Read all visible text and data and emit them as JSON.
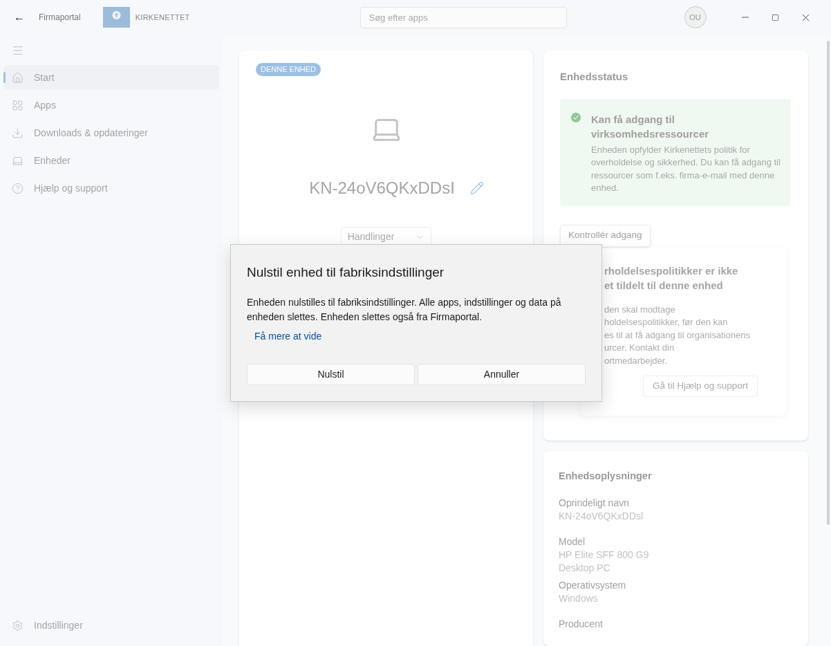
{
  "title_bar": {
    "back": "←",
    "app_name": "Firmaportal",
    "org_name": "KIRKENETTET",
    "search": {
      "placeholder": "Søg efter apps"
    },
    "avatar": "OU"
  },
  "sidebar": {
    "items": [
      {
        "label": "Start",
        "kind": "home",
        "selected": true
      },
      {
        "label": "Apps",
        "kind": "apps",
        "selected": false
      },
      {
        "label": "Downloads & opdateringer",
        "kind": "download",
        "selected": false
      },
      {
        "label": "Enheder",
        "kind": "laptop",
        "selected": false
      },
      {
        "label": "Hjælp og support",
        "kind": "help",
        "selected": false
      }
    ],
    "settings": "Indstillinger"
  },
  "device_card": {
    "badge": "DENNE ENHED",
    "name": "KN-24oV6QKxDDsI",
    "actions": "Handlinger"
  },
  "status_card": {
    "title": "Enhedsstatus",
    "status": {
      "heading": "Kan få adgang til virksomhedsressourcer",
      "body": "Enheden opfylder Kirkenettets politik for overholdelse og sikkerhed. Du kan få adgang til ressourcer som f.eks. firma-e-mail med denne enhed."
    },
    "check_button": "Kontrollér adgang",
    "policy": {
      "heading_lines": [
        "rholdelsespolitikker er ikke",
        "et tildelt til denne enhed"
      ],
      "body_lines": [
        "den skal modtage",
        "holdelsespolitikker, før den kan",
        "es til at få adgang til organisationens",
        "urcer. Kontakt din",
        "ortmedarbejder."
      ],
      "button": "Gå til Hjælp og support"
    }
  },
  "info_card": {
    "title": "Enhedsoplysninger",
    "fields": [
      {
        "label": "Oprindeligt navn",
        "value_lines": [
          "KN-24oV6QKxDDsl"
        ]
      },
      {
        "label": "Model",
        "value_lines": [
          "HP Elite SFF 800 G9",
          "Desktop PC"
        ]
      },
      {
        "label": "Operativsystem",
        "value_lines": [
          "Windows"
        ]
      },
      {
        "label": "Producent"
      }
    ]
  },
  "dialog": {
    "title": "Nulstil enhed til fabriksindstillinger",
    "body": "Enheden nulstilles til fabriksindstillinger. Alle apps, indstillinger og data på enheden slettes. Enheden slettes også fra Firmaportal.",
    "link": "Få mere at vide",
    "buttons": [
      "Nulstil",
      "Annuller"
    ]
  }
}
